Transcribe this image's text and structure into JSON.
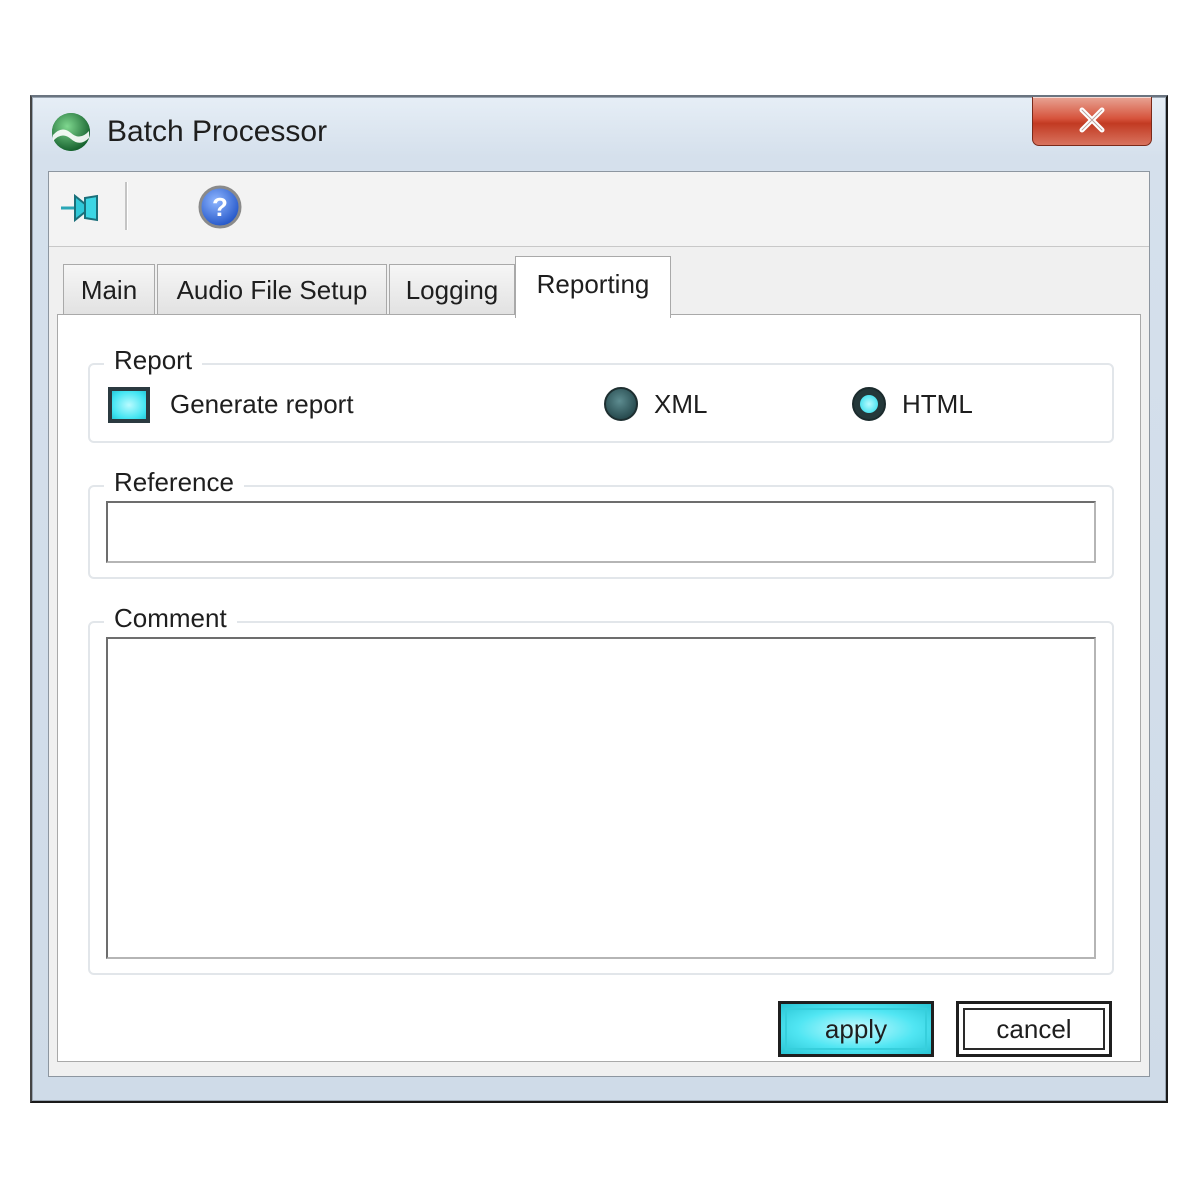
{
  "window": {
    "title": "Batch Processor"
  },
  "toolbar": {
    "pin_icon": "pin-icon",
    "help_icon": "help-icon"
  },
  "tabs": [
    {
      "label": "Main",
      "active": false
    },
    {
      "label": "Audio File Setup",
      "active": false
    },
    {
      "label": "Logging",
      "active": false
    },
    {
      "label": "Reporting",
      "active": true
    }
  ],
  "report_group": {
    "label": "Report",
    "generate_report_label": "Generate report",
    "generate_report_checked": true,
    "format_options": [
      {
        "label": "XML",
        "selected": false
      },
      {
        "label": "HTML",
        "selected": true
      }
    ]
  },
  "reference_group": {
    "label": "Reference",
    "value": ""
  },
  "comment_group": {
    "label": "Comment",
    "value": ""
  },
  "buttons": {
    "apply_label": "apply",
    "cancel_label": "cancel"
  },
  "colors": {
    "accent": "#42e4f2",
    "close_red": "#c23a22"
  }
}
